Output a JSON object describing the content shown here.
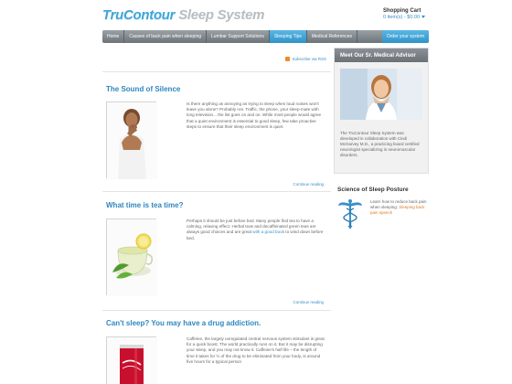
{
  "header": {
    "brand": "TruContour",
    "system": "Sleep System",
    "cart_title": "Shopping Cart",
    "cart_items": "0 item(s) - $0.00"
  },
  "nav": {
    "items": [
      {
        "label": "Home"
      },
      {
        "label": "Causes of back pain when sleeping"
      },
      {
        "label": "Lumbar Support Solutions"
      },
      {
        "label": "Sleeping Tips"
      },
      {
        "label": "Medical References"
      }
    ],
    "order_label": "Order your system"
  },
  "main": {
    "rss": "Subscribe via RSS",
    "posts": [
      {
        "title": "The Sound of Silence",
        "text": "Is there anything as annoying as trying to sleep when loud noises won't leave you alone? Probably not. Traffic, the phone, your sleep-mate with long television... the list goes on and on. While most people would agree that a quiet environment is essential to good sleep, few take proactive steps to ensure that their sleep environment is quiet.",
        "more": "Continue reading"
      },
      {
        "title": "What time is tea time?",
        "text": "Perhaps it should be just before bed.  Many people find tea to have a calming, relaxing effect.  Herbal teas and decaffeinated green teas are always good choices and are great ",
        "link": "with a good book",
        "text_after": " to wind down before bed.",
        "more": "Continue reading"
      },
      {
        "title": "Can't sleep? You may have a drug addiction.",
        "text": "Caffeine, the largely unregulated central nervous system stimulant is great for a quick boost. The world practically runs on it.  But it may be disrupting your sleep, and you may not know it. Caffeine's half life – the length of time it takes for ½ of the drug to be eliminated from your body, is around five hours for a typical person"
      }
    ]
  },
  "sidebar": {
    "advisor_title": "Meet Our Sr. Medical Advisor",
    "advisor_text": "The TruContour Sleep System was developed in collaboration with Cindi McGarvey M.D., a practicing board certified neurologist specializing in neuromuscular disorders.",
    "science_title": "Science of Sleep Posture",
    "science_text": "Learn how to reduce back pain when sleeping: ",
    "science_link": "Sleeping back pain speech"
  },
  "colors": {
    "accent": "#2e87c0",
    "nav_active": "#3fa6d8"
  }
}
